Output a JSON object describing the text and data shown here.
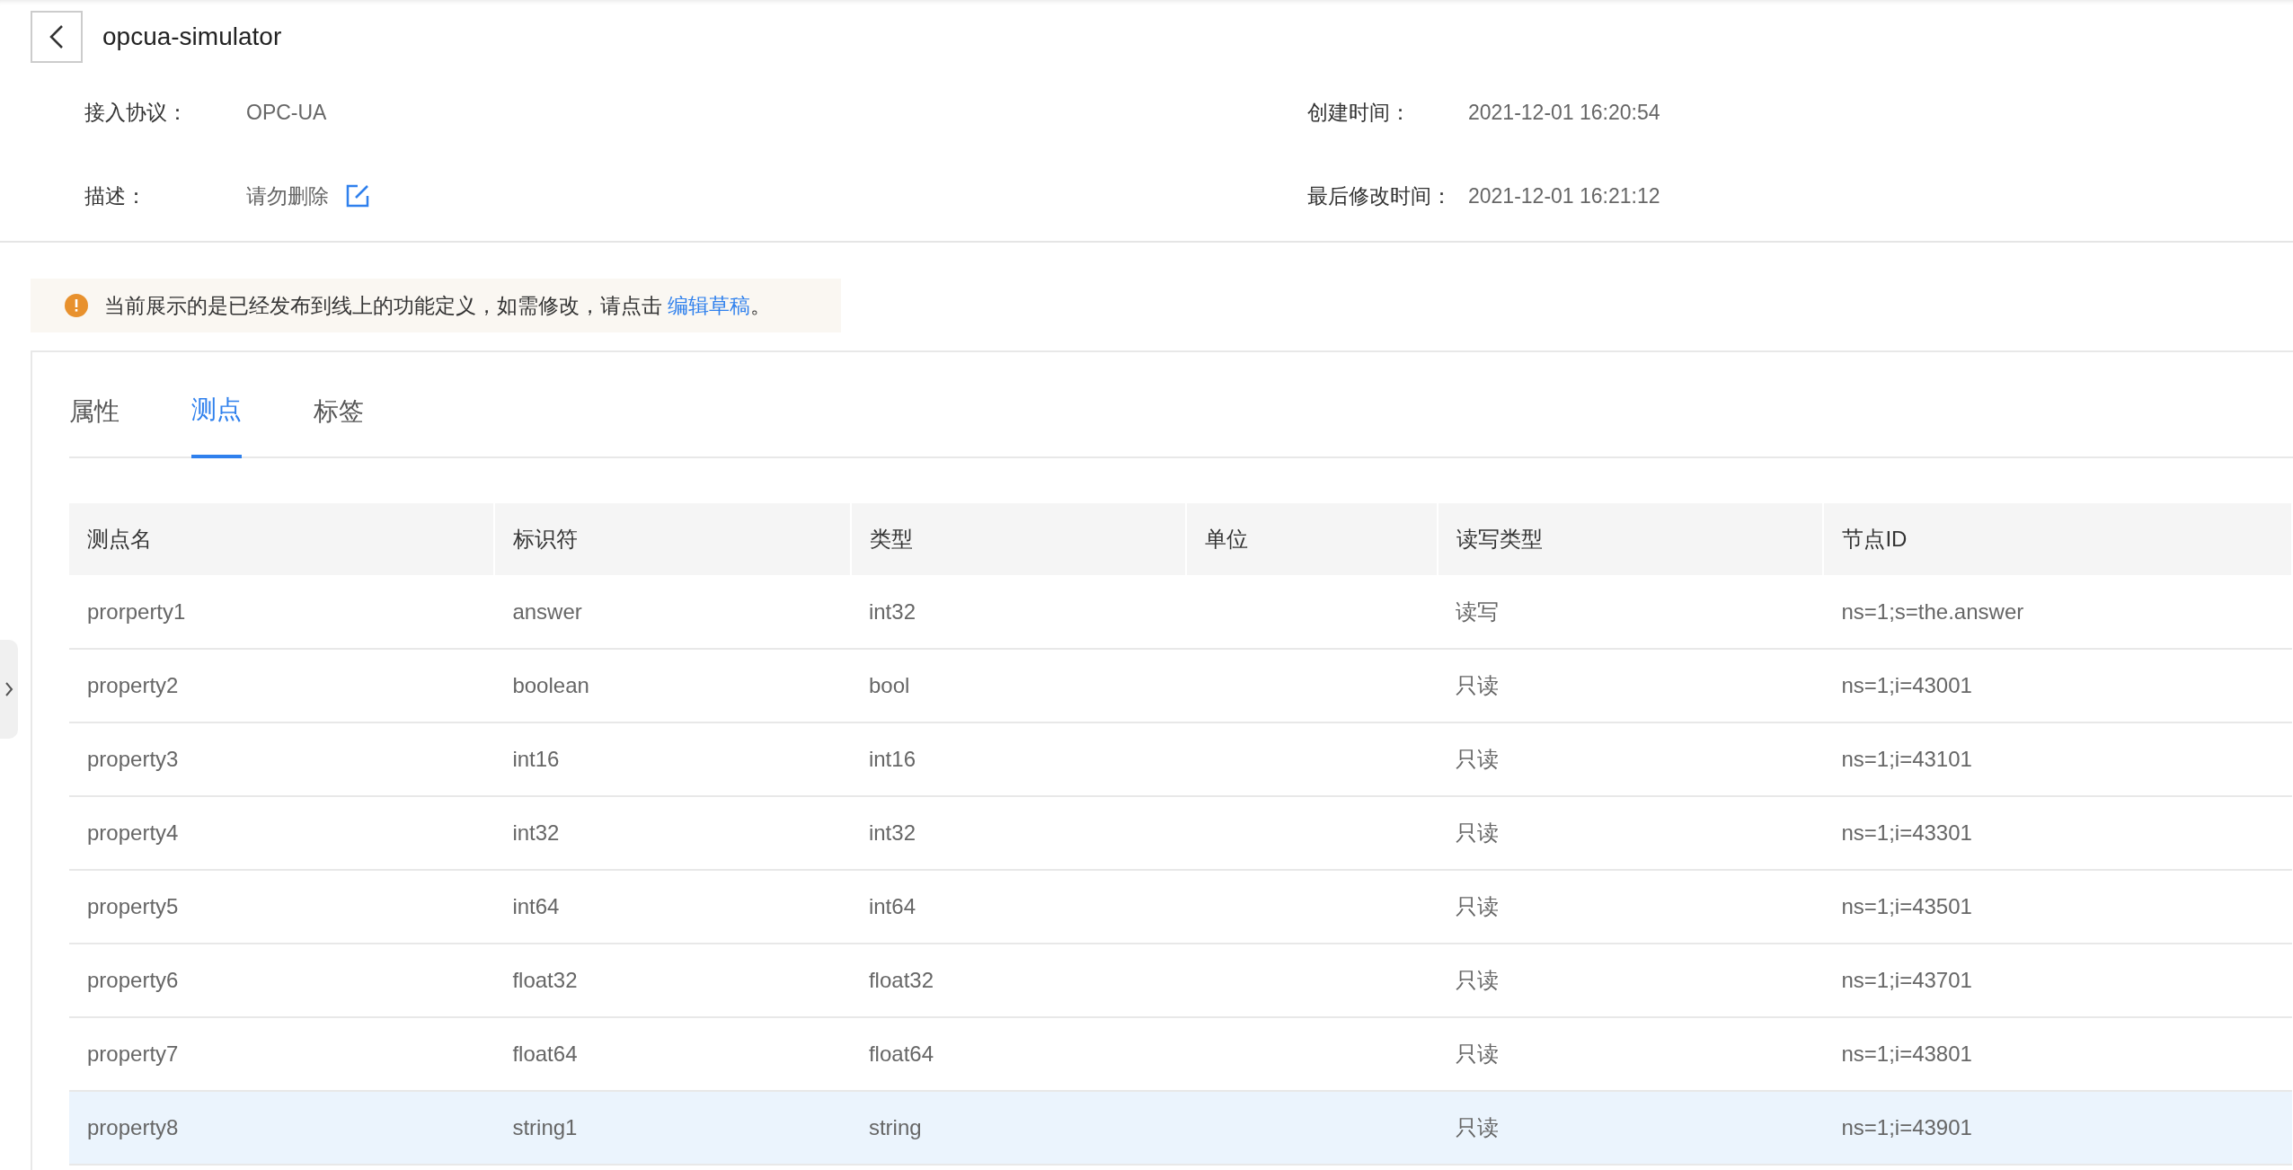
{
  "header": {
    "title": "opcua-simulator"
  },
  "info": [
    {
      "label": "接入协议：",
      "value": "OPC-UA"
    },
    {
      "label": "创建时间：",
      "value": "2021-12-01 16:20:54"
    },
    {
      "label": "描述：",
      "value": "请勿删除",
      "editable": true
    },
    {
      "label": "最后修改时间：",
      "value": "2021-12-01 16:21:12"
    }
  ],
  "notice": {
    "text": "当前展示的是已经发布到线上的功能定义，如需修改，请点击",
    "link": "编辑草稿",
    "suffix": "。"
  },
  "tabs": [
    {
      "label": "属性",
      "selected": false
    },
    {
      "label": "测点",
      "selected": true
    },
    {
      "label": "标签",
      "selected": false
    }
  ],
  "table": {
    "columns": [
      "测点名",
      "标识符",
      "类型",
      "单位",
      "读写类型",
      "节点ID"
    ],
    "rows": [
      {
        "cells": [
          "prorperty1",
          "answer",
          "int32",
          "",
          "读写",
          "ns=1;s=the.answer"
        ],
        "selected": false
      },
      {
        "cells": [
          "property2",
          "boolean",
          "bool",
          "",
          "只读",
          "ns=1;i=43001"
        ],
        "selected": false
      },
      {
        "cells": [
          "property3",
          "int16",
          "int16",
          "",
          "只读",
          "ns=1;i=43101"
        ],
        "selected": false
      },
      {
        "cells": [
          "property4",
          "int32",
          "int32",
          "",
          "只读",
          "ns=1;i=43301"
        ],
        "selected": false
      },
      {
        "cells": [
          "property5",
          "int64",
          "int64",
          "",
          "只读",
          "ns=1;i=43501"
        ],
        "selected": false
      },
      {
        "cells": [
          "property6",
          "float32",
          "float32",
          "",
          "只读",
          "ns=1;i=43701"
        ],
        "selected": false
      },
      {
        "cells": [
          "property7",
          "float64",
          "float64",
          "",
          "只读",
          "ns=1;i=43801"
        ],
        "selected": false
      },
      {
        "cells": [
          "property8",
          "string1",
          "string",
          "",
          "只读",
          "ns=1;i=43901"
        ],
        "selected": true
      }
    ]
  }
}
